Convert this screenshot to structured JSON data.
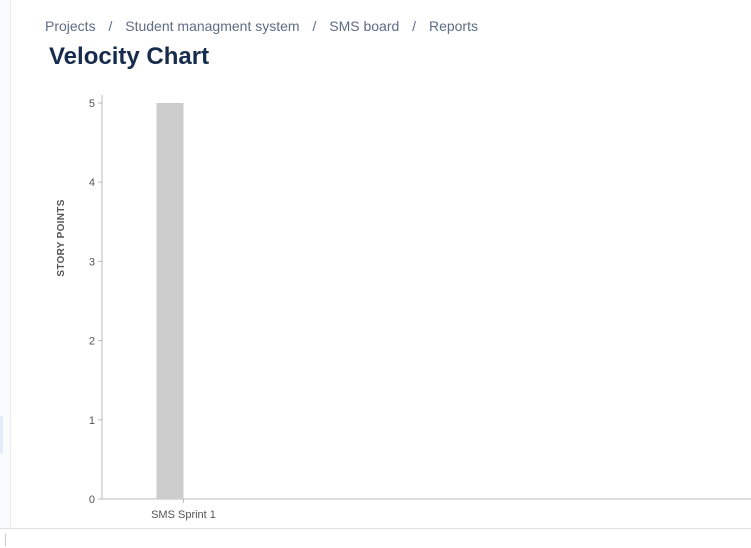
{
  "breadcrumb": {
    "items": [
      "Projects",
      "Student managment system",
      "SMS board",
      "Reports"
    ],
    "separator": "/"
  },
  "page": {
    "title": "Velocity Chart"
  },
  "chart_data": {
    "type": "bar",
    "title": "",
    "xlabel": "",
    "ylabel": "STORY POINTS",
    "categories": [
      "SMS Sprint 1"
    ],
    "series": [
      {
        "values": [
          5
        ],
        "color": "#cccccc"
      }
    ],
    "ylim": [
      0,
      5
    ],
    "yticks": [
      0,
      1,
      2,
      3,
      4,
      5
    ],
    "grid": false,
    "legend": "none"
  },
  "colors": {
    "title": "#172b4d",
    "breadcrumb": "#5e6c84",
    "axis": "#bbbbbb",
    "tick_label": "#555555",
    "bar": "#cccccc"
  }
}
